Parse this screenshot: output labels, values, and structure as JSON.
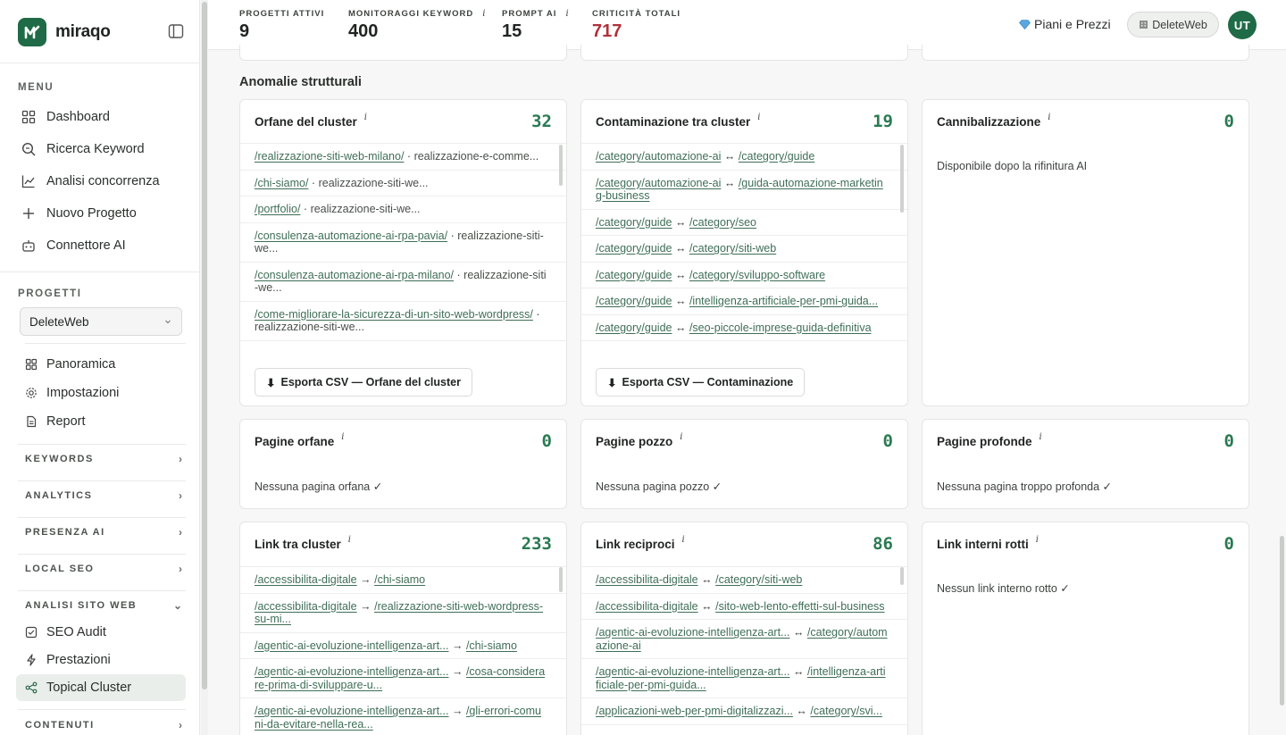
{
  "brand": {
    "name": "miraqo"
  },
  "sidebar": {
    "menu_title": "MENU",
    "menu": [
      {
        "label": "Dashboard",
        "icon": "grid-icon"
      },
      {
        "label": "Ricerca Keyword",
        "icon": "search-icon"
      },
      {
        "label": "Analisi concorrenza",
        "icon": "chart-line-icon"
      },
      {
        "label": "Nuovo Progetto",
        "icon": "plus-icon"
      },
      {
        "label": "Connettore AI",
        "icon": "robot-icon"
      }
    ],
    "projects_title": "PROGETTI",
    "project_selected": "DeleteWeb",
    "project_items": [
      {
        "label": "Panoramica",
        "icon": "grid-small-icon"
      },
      {
        "label": "Impostazioni",
        "icon": "gear-icon"
      },
      {
        "label": "Report",
        "icon": "document-icon"
      }
    ],
    "groups": [
      "KEYWORDS",
      "ANALYTICS",
      "PRESENZA AI",
      "LOCAL SEO"
    ],
    "open_group": "ANALISI SITO WEB",
    "open_group_items": [
      {
        "label": "SEO Audit",
        "icon": "checkbox-icon"
      },
      {
        "label": "Prestazioni",
        "icon": "bolt-icon"
      },
      {
        "label": "Topical Cluster",
        "icon": "share-icon"
      }
    ],
    "last_group": "CONTENUTI"
  },
  "header": {
    "stats": [
      {
        "label": "PROGETTI ATTIVI",
        "value": "9",
        "info": ""
      },
      {
        "label": "MONITORAGGI KEYWORD",
        "value": "400",
        "info": "i"
      },
      {
        "label": "PROMPT AI",
        "value": "15",
        "info": "i"
      },
      {
        "label": "CRITICITÀ TOTALI",
        "value": "717",
        "info": ""
      }
    ],
    "plans_label": "Piani e Prezzi",
    "workspace_label": "DeleteWeb",
    "avatar_initials": "UT"
  },
  "section_title": "Anomalie strutturali",
  "cards": {
    "orfane_cluster": {
      "title": "Orfane del cluster",
      "count": "32",
      "rows": [
        {
          "link": "/realizzazione-siti-web-milano/",
          "rest": "realizzazione-e-comme..."
        },
        {
          "link": "/chi-siamo/",
          "rest": "realizzazione-siti-we..."
        },
        {
          "link": "/portfolio/",
          "rest": "realizzazione-siti-we..."
        },
        {
          "link": "/consulenza-automazione-ai-rpa-pavia/",
          "rest": "realizzazione-siti-we..."
        },
        {
          "link": "/consulenza-automazione-ai-rpa-milano/",
          "rest": "realizzazione-siti-we..."
        },
        {
          "link": "/come-migliorare-la-sicurezza-di-un-sito-web-wordpress/",
          "rest": "realizzazione-siti-we..."
        }
      ],
      "export_label": "Esporta CSV — Orfane del cluster"
    },
    "contaminazione": {
      "title": "Contaminazione tra cluster",
      "count": "19",
      "rows": [
        {
          "a": "/category/automazione-ai",
          "b": "/category/guide"
        },
        {
          "a": "/category/automazione-ai",
          "b": "/guida-automazione-marketing-business"
        },
        {
          "a": "/category/guide",
          "b": "/category/seo"
        },
        {
          "a": "/category/guide",
          "b": "/category/siti-web"
        },
        {
          "a": "/category/guide",
          "b": "/category/sviluppo-software"
        },
        {
          "a": "/category/guide",
          "b": "/intelligenza-artificiale-per-pmi-guida..."
        },
        {
          "a": "/category/guide",
          "b": "/seo-piccole-imprese-guida-definitiva"
        }
      ],
      "export_label": "Esporta CSV — Contaminazione"
    },
    "cannibalizzazione": {
      "title": "Cannibalizzazione",
      "count": "0",
      "message": "Disponibile dopo la rifinitura AI"
    },
    "pagine_orfane": {
      "title": "Pagine orfane",
      "count": "0",
      "message": "Nessuna pagina orfana ✓"
    },
    "pagine_pozzo": {
      "title": "Pagine pozzo",
      "count": "0",
      "message": "Nessuna pagina pozzo ✓"
    },
    "pagine_profonde": {
      "title": "Pagine profonde",
      "count": "0",
      "message": "Nessuna pagina troppo profonda ✓"
    },
    "link_tra_cluster": {
      "title": "Link tra cluster",
      "count": "233",
      "rows": [
        {
          "a": "/accessibilita-digitale",
          "b": "/chi-siamo"
        },
        {
          "a": "/accessibilita-digitale",
          "b": "/realizzazione-siti-web-wordpress-su-mi..."
        },
        {
          "a": "/agentic-ai-evoluzione-intelligenza-art...",
          "b": "/chi-siamo"
        },
        {
          "a": "/agentic-ai-evoluzione-intelligenza-art...",
          "b": "/cosa-considerare-prima-di-sviluppare-u..."
        },
        {
          "a": "/agentic-ai-evoluzione-intelligenza-art...",
          "b": "/gli-errori-comuni-da-evitare-nella-rea..."
        }
      ]
    },
    "link_reciproci": {
      "title": "Link reciproci",
      "count": "86",
      "rows": [
        {
          "a": "/accessibilita-digitale",
          "b": "/category/siti-web"
        },
        {
          "a": "/accessibilita-digitale",
          "b": "/sito-web-lento-effetti-sul-business"
        },
        {
          "a": "/agentic-ai-evoluzione-intelligenza-art...",
          "b": "/category/automazione-ai"
        },
        {
          "a": "/agentic-ai-evoluzione-intelligenza-art...",
          "b": "/intelligenza-artificiale-per-pmi-guida..."
        },
        {
          "a": "/applicazioni-web-per-pmi-digitalizzazi...",
          "b": "/category/svi..."
        }
      ]
    },
    "link_rotti": {
      "title": "Link interni rotti",
      "count": "0",
      "message": "Nessun link interno rotto ✓"
    }
  },
  "info_glyph": "i",
  "arrow_right": "→",
  "arrow_both": "↔",
  "dot": "·",
  "download_glyph": "⬇",
  "colors": {
    "brand": "#1f6b47",
    "count": "#2a7a52",
    "critical": "#b0303a",
    "link": "#3f6e57"
  }
}
